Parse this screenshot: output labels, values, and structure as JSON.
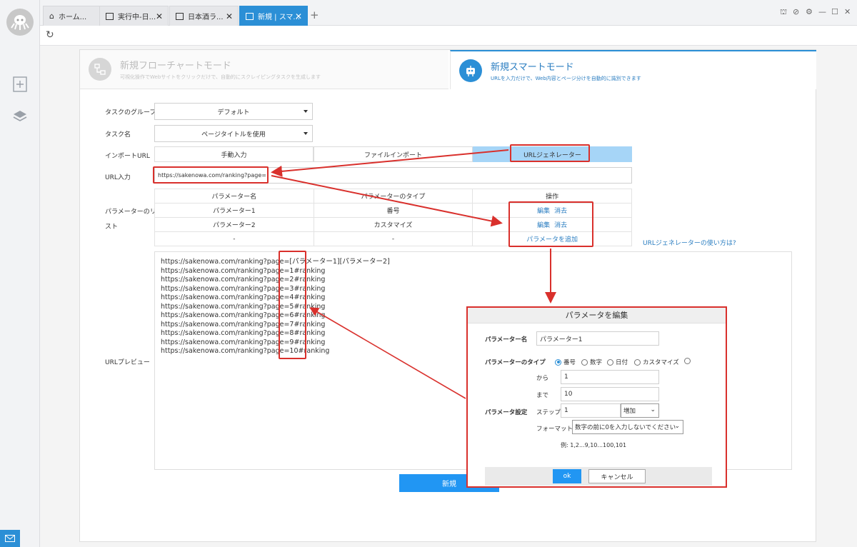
{
  "tabs": [
    {
      "label": "ホーム..."
    },
    {
      "label": "実行中-日..."
    },
    {
      "label": "日本酒ラ..."
    },
    {
      "label": "新規 | スマ..."
    }
  ],
  "window_controls": {
    "gift": "⌘",
    "help": "?",
    "settings": "⚙",
    "minimize": "—",
    "maximize": "☐",
    "close": "✕"
  },
  "modes": {
    "flowchart": {
      "title": "新規フローチャートモード",
      "desc": "可視化操作でWebサイトをクリックだけで、自動的にスクレイピングタスクを生成します"
    },
    "smart": {
      "title": "新規スマートモード",
      "desc": "URLを入力だけで、Web内容とページ分けを自動的に識別できます"
    }
  },
  "form": {
    "group_label": "タスクのグループ",
    "group_value": "デフォルト",
    "name_label": "タスク名",
    "name_value": "ページタイトルを使用",
    "import_label": "インポートURL",
    "import_tabs": [
      "手動入力",
      "ファイルインポート",
      "URLジェネレーター"
    ],
    "url_label": "URL入力",
    "url_value": "https://sakenowa.com/ranking?page=",
    "param_list_label_1": "パラメーターのリ",
    "param_list_label_2": "スト",
    "preview_label": "URLプレビュー",
    "help_link": "URLジェネレーターの使い方は?",
    "new_button": "新規"
  },
  "param_table": {
    "headers": [
      "パラメーター名",
      "パラメーターのタイプ",
      "操作"
    ],
    "rows": [
      {
        "name": "パラメーター1",
        "type": "番号",
        "edit": "編集",
        "delete": "消去"
      },
      {
        "name": "パラメーター2",
        "type": "カスタマイズ",
        "edit": "編集",
        "delete": "消去"
      }
    ],
    "empty_row": {
      "name": "-",
      "type": "-",
      "action": "パラメータを追加"
    }
  },
  "preview_lines": [
    "https://sakenowa.com/ranking?page=[パラメーター1][パラメーター2]",
    "https://sakenowa.com/ranking?page=1#ranking",
    "https://sakenowa.com/ranking?page=2#ranking",
    "https://sakenowa.com/ranking?page=3#ranking",
    "https://sakenowa.com/ranking?page=4#ranking",
    "https://sakenowa.com/ranking?page=5#ranking",
    "https://sakenowa.com/ranking?page=6#ranking",
    "https://sakenowa.com/ranking?page=7#ranking",
    "https://sakenowa.com/ranking?page=8#ranking",
    "https://sakenowa.com/ranking?page=9#ranking",
    "https://sakenowa.com/ranking?page=10#ranking"
  ],
  "dialog": {
    "title": "パラメータを編集",
    "name_label": "パラメーター名",
    "name_value": "パラメーター1",
    "type_label": "パラメーターのタイプ",
    "type_options": [
      "番号",
      "数字",
      "日付",
      "カスタマイズ",
      ""
    ],
    "type_selected": "番号",
    "from_label": "から",
    "from_value": "1",
    "to_label": "まで",
    "to_value": "10",
    "setting_label": "パラメータ設定",
    "step_label": "ステップ",
    "step_value": "1",
    "step_mode": "増加",
    "format_label": "フォーマット",
    "format_value": "数字の前に0を入力しないでください",
    "example": "例: 1,2...9,10...100,101",
    "ok": "ok",
    "cancel": "キャンセル"
  },
  "colors": {
    "accent": "#2196f3",
    "annotation": "#d9302c",
    "active_tab": "#a6d5f7"
  }
}
